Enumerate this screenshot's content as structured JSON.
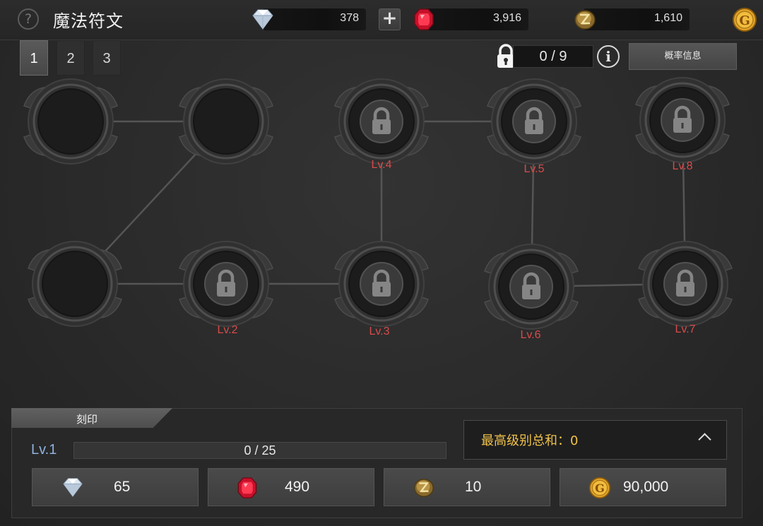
{
  "window": {
    "title": "魔法符文",
    "help_symbol": "?"
  },
  "currencies": [
    {
      "icon": "diamond-icon",
      "value": "378"
    },
    {
      "icon": "ruby-icon",
      "value": "3,916"
    },
    {
      "icon": "rune-stone-icon",
      "value": "1,610"
    },
    {
      "icon": "gold-coin-icon",
      "value": "G"
    }
  ],
  "add_button": "+",
  "pages": {
    "tabs": [
      "1",
      "2",
      "3"
    ],
    "active": 0
  },
  "locks": {
    "icon": "padlock-icon",
    "count": "0 / 9"
  },
  "info_symbol": "i",
  "probability_button": "概率信息",
  "slots": [
    {
      "state": "empty",
      "level": ""
    },
    {
      "state": "empty",
      "level": ""
    },
    {
      "state": "locked",
      "level": "Lv.4"
    },
    {
      "state": "locked",
      "level": "Lv.5"
    },
    {
      "state": "locked",
      "level": "Lv.8"
    },
    {
      "state": "empty",
      "level": ""
    },
    {
      "state": "locked",
      "level": "Lv.2"
    },
    {
      "state": "locked",
      "level": "Lv.3"
    },
    {
      "state": "locked",
      "level": "Lv.6"
    },
    {
      "state": "locked",
      "level": "Lv.7"
    }
  ],
  "engrave": {
    "tab_label": "刻印",
    "current_level": "Lv.1",
    "progress": {
      "current": 0,
      "max": 25,
      "text": "0 / 25"
    },
    "max_level_sum": "最高级别总和：0",
    "costs": [
      {
        "icon": "diamond-icon",
        "value": "65"
      },
      {
        "icon": "ruby-icon",
        "value": "490"
      },
      {
        "icon": "rune-stone-icon",
        "value": "10"
      },
      {
        "icon": "gold-coin-icon",
        "value": "90,000"
      }
    ]
  },
  "colors": {
    "level_label": "#d94a4a",
    "level_text": "#8fb2dc",
    "sum_text": "#f0c14a",
    "ruby": "#e0192e",
    "gold": "#e2a52a"
  }
}
